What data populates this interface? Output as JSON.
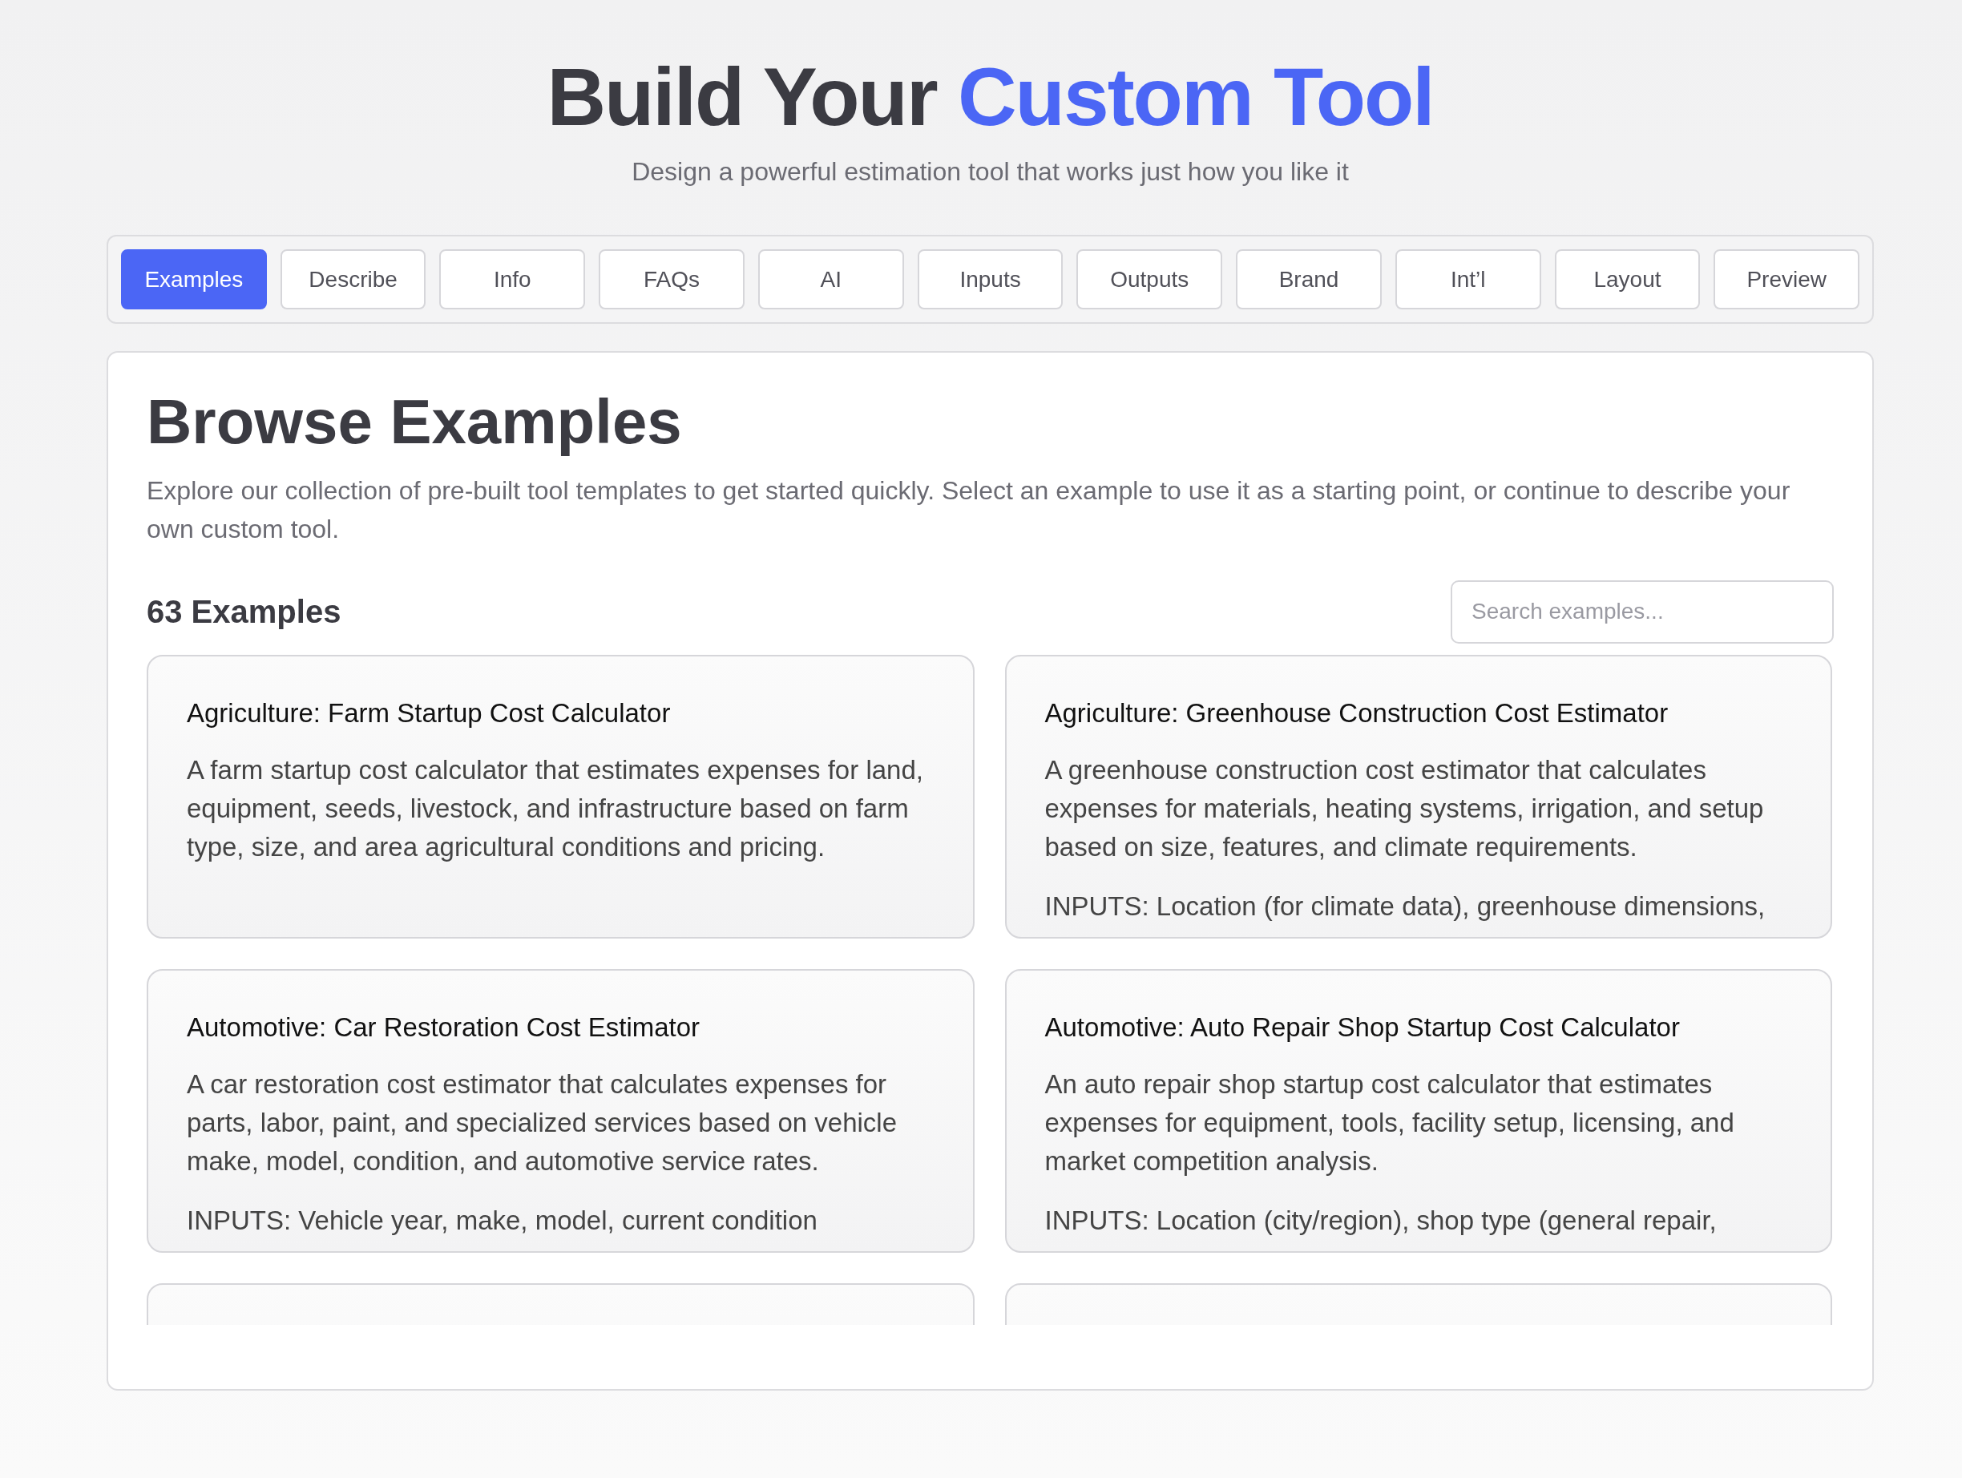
{
  "header": {
    "title_plain": "Build Your ",
    "title_accent": "Custom Tool",
    "subtitle": "Design a powerful estimation tool that works just how you like it"
  },
  "tabs": [
    {
      "label": "Examples",
      "selected": true
    },
    {
      "label": "Describe",
      "selected": false
    },
    {
      "label": "Info",
      "selected": false
    },
    {
      "label": "FAQs",
      "selected": false
    },
    {
      "label": "AI",
      "selected": false
    },
    {
      "label": "Inputs",
      "selected": false
    },
    {
      "label": "Outputs",
      "selected": false
    },
    {
      "label": "Brand",
      "selected": false
    },
    {
      "label": "Int’l",
      "selected": false
    },
    {
      "label": "Layout",
      "selected": false
    },
    {
      "label": "Preview",
      "selected": false
    }
  ],
  "panel": {
    "heading": "Browse Examples",
    "description": "Explore our collection of pre-built tool templates to get started quickly. Select an example to use it as a starting point, or continue to describe your own custom tool.",
    "count": "63 Examples",
    "search": {
      "placeholder": "Search examples..."
    },
    "examples": [
      {
        "kind": "full",
        "title": "Agriculture: Farm Startup Cost Calculator",
        "description": "A farm startup cost calculator that estimates expenses for land, equipment, seeds, livestock, and infrastructure based on farm type, size, and area agricultural conditions and pricing."
      },
      {
        "kind": "full",
        "title": "Agriculture: Greenhouse Construction Cost Estimator",
        "description": "A greenhouse construction cost estimator that calculates expenses for materials, heating systems, irrigation, and setup based on size, features, and climate requirements.",
        "inputs": "INPUTS: Location (for climate data), greenhouse dimensions,"
      },
      {
        "kind": "full",
        "title": "Automotive: Car Restoration Cost Estimator",
        "description": "A car restoration cost estimator that calculates expenses for parts, labor, paint, and specialized services based on vehicle make, model, condition, and automotive service rates.",
        "inputs": "INPUTS: Vehicle year, make, model, current condition"
      },
      {
        "kind": "full",
        "title": "Automotive: Auto Repair Shop Startup Cost Calculator",
        "description": "An auto repair shop startup cost calculator that estimates expenses for equipment, tools, facility setup, licensing, and market competition analysis.",
        "inputs": "INPUTS: Location (city/region), shop type (general repair,"
      },
      {
        "kind": "cut_off"
      },
      {
        "kind": "cut_off"
      }
    ]
  }
}
